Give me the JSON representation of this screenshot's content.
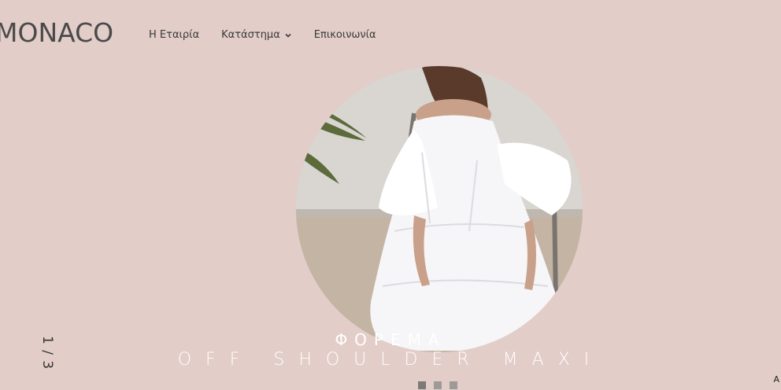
{
  "brand": {
    "logo_text": "MONACO"
  },
  "nav": {
    "items": [
      {
        "label": "Η Εταιρία"
      },
      {
        "label": "Κατάστημα",
        "has_dropdown": true,
        "icon": "chevron-down-icon"
      },
      {
        "label": "Επικοινωνία"
      }
    ]
  },
  "slider": {
    "counter": "1 / 3",
    "current": 1,
    "total": 3,
    "category": "ΦΟΡΕΜΑ",
    "product": "OFF SHOULDER MAXI",
    "image": "woman-in-white-off-shoulder-maxi-dress",
    "dots": [
      {
        "active": true
      },
      {
        "active": false
      },
      {
        "active": false
      }
    ]
  },
  "corner_text": "A",
  "colors": {
    "background": "#e2cdc8",
    "text": "#3a3a3a",
    "caption": "#ffffff"
  }
}
